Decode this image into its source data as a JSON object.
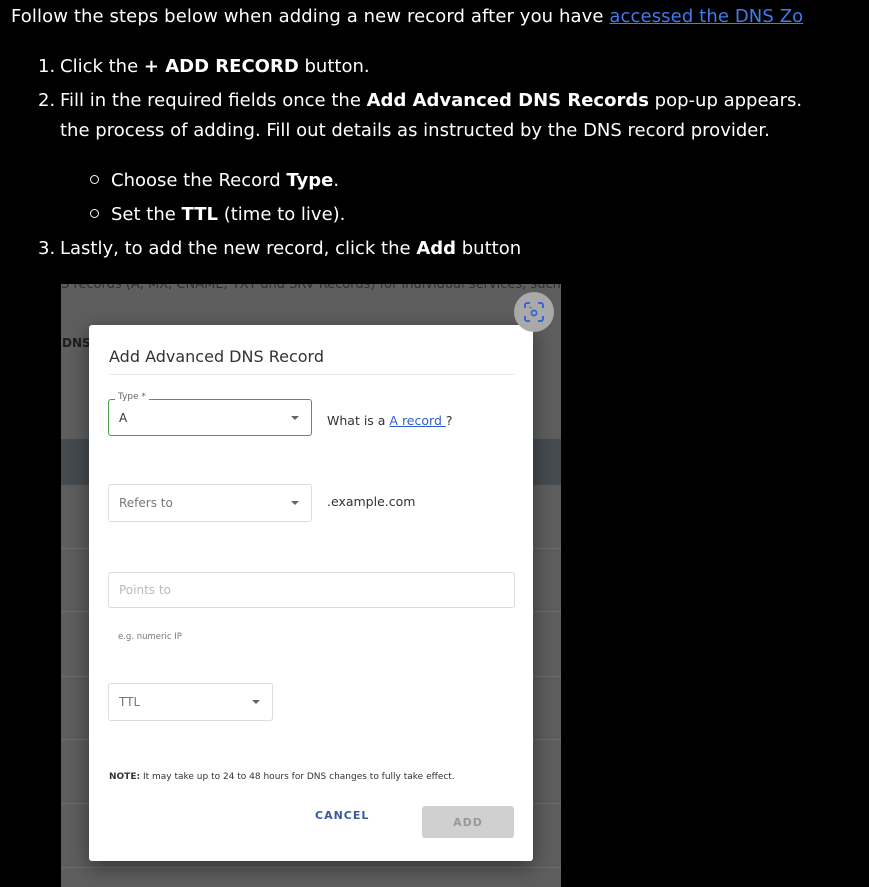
{
  "intro": {
    "text": "Follow the steps below when adding a new record after you have ",
    "link_text": "accessed the DNS Zo",
    "link_color": "#3f7cf0"
  },
  "steps": [
    {
      "num": "1.",
      "pre": "Click the ",
      "bold": "+ ADD RECORD",
      "post": " button."
    },
    {
      "num": "2.",
      "pre": "Fill in the required fields once the ",
      "bold": "Add Advanced DNS Records",
      "post": " pop-up appears.",
      "continuation": "the process of adding. Fill out details as instructed by the DNS record provider."
    },
    {
      "num": "3.",
      "pre": "Lastly, to add the new record, click the ",
      "bold": "Add",
      "post": " button"
    }
  ],
  "substeps": [
    {
      "pre": "Choose the Record ",
      "bold": "Type",
      "post": "."
    },
    {
      "pre": "Set the ",
      "bold": "TTL",
      "post": " (time to live)."
    }
  ],
  "screenshot": {
    "top_text": "S records (A, MX, CNAME, TXT and SRV Records) for individual services, such as chat",
    "side_label": "DNS",
    "scan_icon": "scan-icon",
    "modal": {
      "title": "Add Advanced DNS Record",
      "type_field": {
        "label": "Type *",
        "value": "A"
      },
      "type_help_pre": "What is a ",
      "type_help_link": "A record ",
      "type_help_post": "?",
      "refers_to": {
        "placeholder": "Refers to",
        "suffix": ".example.com"
      },
      "points_to": {
        "placeholder": "Points to",
        "hint": "e.g. numeric IP"
      },
      "ttl": {
        "placeholder": "TTL"
      },
      "note_label": "NOTE:",
      "note_text": " It may take up to 24 to 48 hours for DNS changes to fully take effect.",
      "cancel_label": "CANCEL",
      "add_label": "ADD"
    }
  }
}
